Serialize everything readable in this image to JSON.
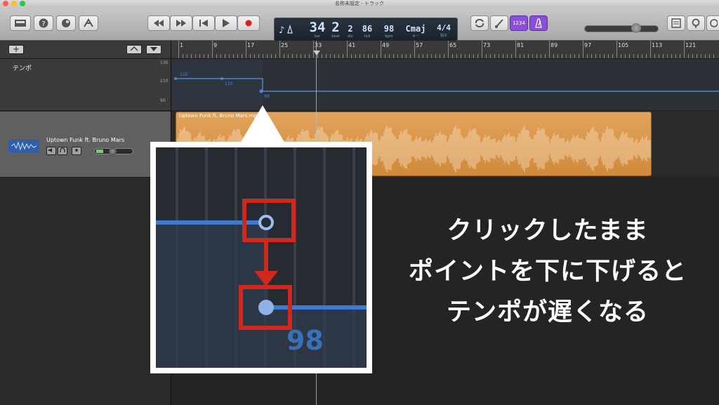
{
  "window": {
    "title": "名称未設定 - トラック",
    "traffic_colors": [
      "#ff5f57",
      "#febc2e",
      "#28c840"
    ]
  },
  "toolbar": {
    "left_buttons": [
      {
        "name": "library-button",
        "icon": "library-icon"
      },
      {
        "name": "quick-help-button",
        "icon": "help-icon",
        "label": "?"
      },
      {
        "name": "smart-controls-button",
        "icon": "smart-controls-icon"
      },
      {
        "name": "editors-button",
        "icon": "editors-icon"
      }
    ],
    "transport": [
      {
        "name": "rewind-button",
        "icon": "rewind-icon"
      },
      {
        "name": "forward-button",
        "icon": "fast-forward-icon"
      },
      {
        "name": "go-to-beginning-button",
        "icon": "skip-back-icon"
      },
      {
        "name": "play-button",
        "icon": "play-icon"
      },
      {
        "name": "record-button",
        "icon": "record-icon",
        "color": "#e02020"
      }
    ],
    "lcd": {
      "bar": "34",
      "bar_label": "bar",
      "beat": "2",
      "beat_label": "beat",
      "div": "2",
      "div_label": "div",
      "tick": "86",
      "tick_label": "tick",
      "tempo": "98",
      "tempo_label": "bpm",
      "key": "Cmaj",
      "key_label": "キー",
      "time_sig": "4/4",
      "time_sig_label": "拍子",
      "accent": "#cfe3ff"
    },
    "right_buttons": [
      {
        "name": "cycle-button",
        "icon": "cycle-icon"
      },
      {
        "name": "tuner-button",
        "icon": "tuner-icon"
      },
      {
        "name": "count-in-button",
        "label": "1234",
        "color": "#8a4fd8"
      },
      {
        "name": "metronome-button",
        "icon": "metronome-icon",
        "color": "#8a4fd8"
      }
    ],
    "far_right_buttons": [
      {
        "name": "notepad-button",
        "icon": "notepad-icon"
      },
      {
        "name": "loop-browser-button",
        "icon": "loop-icon"
      },
      {
        "name": "media-browser-button",
        "icon": "media-icon"
      }
    ],
    "master_volume": 0.72
  },
  "tracks_header": {
    "add_label": "+"
  },
  "tempo_track": {
    "label": "テンポ",
    "scale_labels": [
      "130",
      "110",
      "90"
    ],
    "point_labels": [
      "110",
      "110",
      "98"
    ],
    "line_color": "#4a86d4"
  },
  "audio_track": {
    "name": "Uptown Funk ft. Bruno Mars",
    "region_name": "Uptown Funk ft. Bruno Mars.mp3",
    "region_color": "#e2a35b",
    "volume": 0.45
  },
  "ruler": {
    "bars": [
      "1",
      "9",
      "17",
      "25",
      "33",
      "41",
      "49",
      "57",
      "65",
      "73",
      "81",
      "89",
      "97",
      "105",
      "113",
      "121"
    ]
  },
  "zoom_callout": {
    "tempo_value": "98",
    "highlight_color": "#d0281e"
  },
  "instruction": {
    "lines": [
      "クリックしたまま",
      "ポイントを下に下げると",
      "テンポが遅くなる"
    ]
  }
}
